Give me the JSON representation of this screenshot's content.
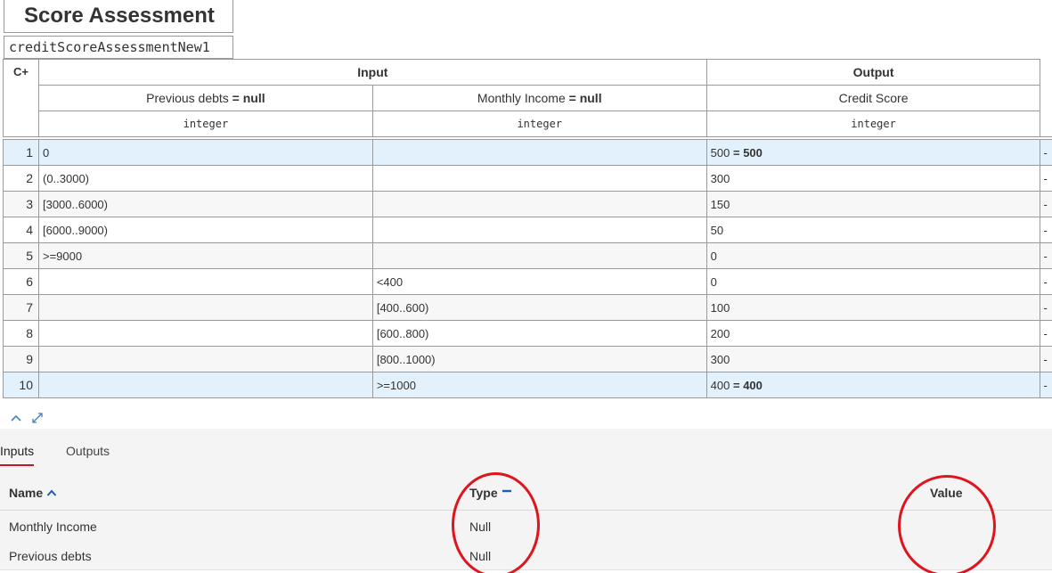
{
  "table": {
    "title": "Score Assessment",
    "id": "creditScoreAssessmentNew1",
    "hit_policy": "C+",
    "input_group": "Input",
    "output_group": "Output",
    "columns": [
      {
        "name": "Previous debts",
        "eq": "=",
        "default": "null",
        "type": "integer"
      },
      {
        "name": "Monthly Income",
        "eq": "=",
        "default": "null",
        "type": "integer"
      },
      {
        "name": "Credit Score",
        "type": "integer"
      }
    ],
    "rules": [
      {
        "num": "1",
        "c1": "0",
        "c2": "",
        "out": "500",
        "out_eq": "= 500",
        "ann": "-",
        "style": "hl"
      },
      {
        "num": "2",
        "c1": "(0..3000)",
        "c2": "",
        "out": "300",
        "out_eq": "",
        "ann": "-",
        "style": "plain"
      },
      {
        "num": "3",
        "c1": "[3000..6000)",
        "c2": "",
        "out": "150",
        "out_eq": "",
        "ann": "-",
        "style": "alt"
      },
      {
        "num": "4",
        "c1": "[6000..9000)",
        "c2": "",
        "out": "50",
        "out_eq": "",
        "ann": "-",
        "style": "plain"
      },
      {
        "num": "5",
        "c1": ">=9000",
        "c2": "",
        "out": "0",
        "out_eq": "",
        "ann": "-",
        "style": "alt"
      },
      {
        "num": "6",
        "c1": "",
        "c2": "<400",
        "out": "0",
        "out_eq": "",
        "ann": "-",
        "style": "plain"
      },
      {
        "num": "7",
        "c1": "",
        "c2": "[400..600)",
        "out": "100",
        "out_eq": "",
        "ann": "-",
        "style": "alt"
      },
      {
        "num": "8",
        "c1": "",
        "c2": "[600..800)",
        "out": "200",
        "out_eq": "",
        "ann": "-",
        "style": "plain"
      },
      {
        "num": "9",
        "c1": "",
        "c2": "[800..1000)",
        "out": "300",
        "out_eq": "",
        "ann": "-",
        "style": "alt"
      },
      {
        "num": "10",
        "c1": "",
        "c2": ">=1000",
        "out": "400",
        "out_eq": "= 400",
        "ann": "-",
        "style": "hl"
      }
    ]
  },
  "tools": {
    "collapse_icon": "chevron-up-icon",
    "expand_icon": "expand-arrows-icon"
  },
  "tabs": [
    {
      "label": "Inputs",
      "active": true
    },
    {
      "label": "Outputs",
      "active": false
    }
  ],
  "variables": {
    "headers": {
      "name": "Name",
      "type": "Type",
      "value": "Value"
    },
    "sort_icon": "sort-up-icon",
    "type_indicator": "dash-icon",
    "rows": [
      {
        "name": "Monthly Income",
        "type": "Null",
        "value": ""
      },
      {
        "name": "Previous debts",
        "type": "Null",
        "value": ""
      }
    ]
  },
  "colors": {
    "accent_red": "#c4171f",
    "circle_red": "#e0141e",
    "highlight_row": "#e2f1fb",
    "sort_blue": "#1a5fb4"
  }
}
